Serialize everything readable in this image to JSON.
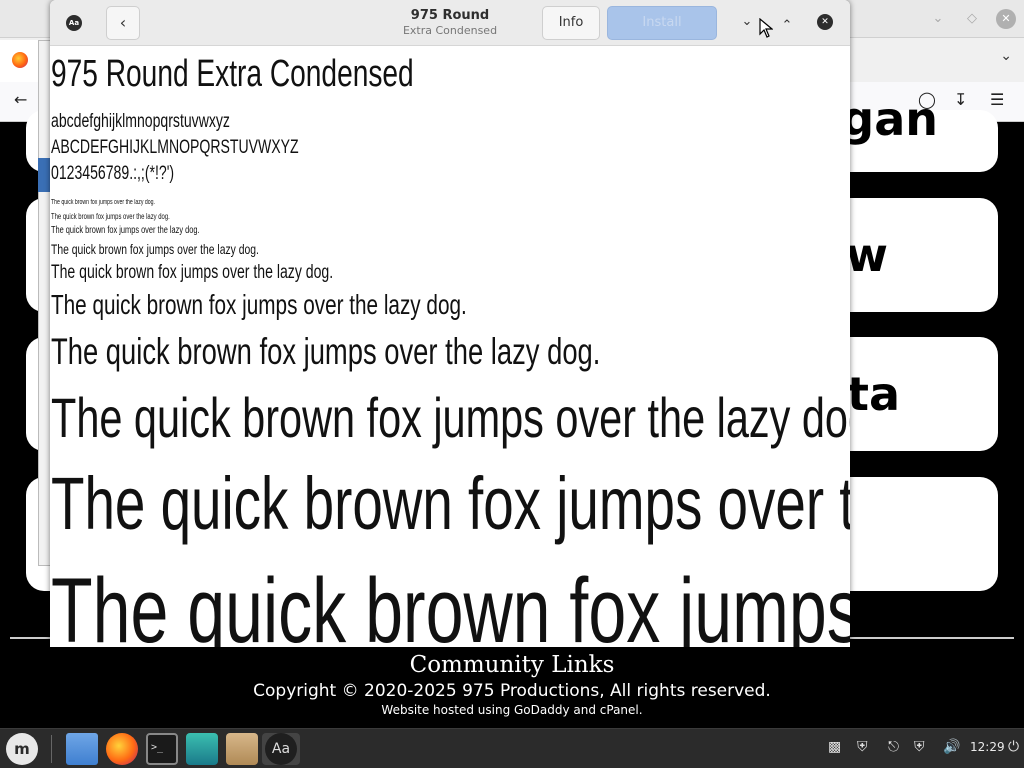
{
  "browser": {
    "tab_list_icon": "chevron-down",
    "back_icon": "arrow-left",
    "toolbar_icons": [
      "pocket",
      "download",
      "menu"
    ]
  },
  "site": {
    "cards": [
      "gan",
      "w",
      "ta",
      ""
    ],
    "footer": {
      "title": "Community Links",
      "copyright": "Copyright © 2020-2025 975 Productions, All rights reserved.",
      "hosting": "Website hosted using GoDaddy and cPanel."
    }
  },
  "font_viewer": {
    "app_icon_label": "Aa",
    "title": "975 Round",
    "subtitle": "Extra Condensed",
    "info_label": "Info",
    "install_label": "Install",
    "specimen": {
      "name": "975 Round Extra Condensed",
      "lowercase": "abcdefghijklmnopqrstuvwxyz",
      "uppercase": "ABCDEFGHIJKLMNOPQRSTUVWXYZ",
      "digits": "0123456789.:,;(*!?')",
      "pangram": "The quick brown fox jumps over the lazy dog."
    }
  },
  "taskbar": {
    "apps": [
      "files",
      "firefox",
      "terminal",
      "settings",
      "archive",
      "font-viewer"
    ],
    "font_viewer_label": "Aa",
    "clock": "12:29"
  }
}
